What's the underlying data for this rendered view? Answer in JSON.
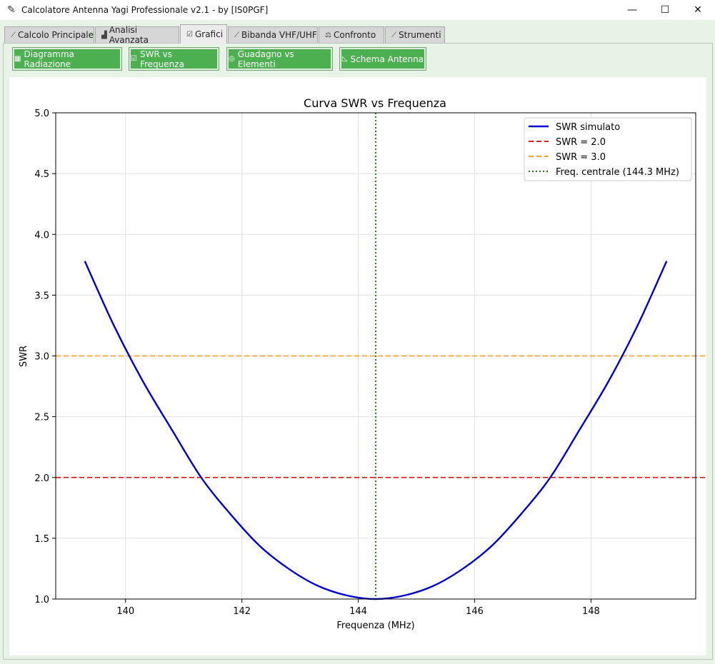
{
  "window": {
    "title": "Calcolatore Antenna Yagi Professionale v2.1 - by [IS0PGF]",
    "app_icon": "feather-icon",
    "controls": {
      "minimize": "—",
      "maximize": "☐",
      "close": "✕"
    }
  },
  "tabs": [
    {
      "label": "Calcolo Principale",
      "icon": "ruler-icon",
      "glyph": "⟋"
    },
    {
      "label": "Analisi Avanzata",
      "icon": "chart-bars-icon",
      "glyph": "▟"
    },
    {
      "label": "Grafici",
      "icon": "checkbox-chart-icon",
      "glyph": "☑"
    },
    {
      "label": "Bibanda VHF/UHF",
      "icon": "antenna-icon",
      "glyph": "⟋"
    },
    {
      "label": "Confronto",
      "icon": "balance-icon",
      "glyph": "⚖"
    },
    {
      "label": "Strumenti",
      "icon": "tools-icon",
      "glyph": "⟋"
    }
  ],
  "active_tab": "Grafici",
  "toolbar": {
    "buttons": [
      {
        "label": "Diagramma Radiazione",
        "icon": "radiation-chart-icon",
        "glyph": "▦"
      },
      {
        "label": "SWR vs Frequenza",
        "icon": "swr-chart-icon",
        "glyph": "☑"
      },
      {
        "label": "Guadagno vs Elementi",
        "icon": "gain-icon",
        "glyph": "◎"
      },
      {
        "label": "Schema Antenna",
        "icon": "antenna-scheme-icon",
        "glyph": "◺"
      }
    ],
    "button_color": "#4caf50"
  },
  "chart_data": {
    "type": "line",
    "title": "Curva SWR vs Frequenza",
    "xlabel": "Frequenza (MHz)",
    "ylabel": "SWR",
    "xlim": [
      138.8,
      149.8
    ],
    "ylim": [
      1.0,
      5.0
    ],
    "xticks": [
      "140",
      "142",
      "144",
      "146",
      "148"
    ],
    "yticks": [
      "1.0",
      "1.5",
      "2.0",
      "2.5",
      "3.0",
      "3.5",
      "4.0",
      "4.5",
      "5.0"
    ],
    "grid": true,
    "legend_position": "top-right",
    "series": [
      {
        "name": "SWR simulato",
        "color": "#0000cc",
        "style": "solid",
        "x": [
          139.3,
          139.8,
          140.3,
          140.8,
          141.3,
          141.8,
          142.3,
          142.8,
          143.3,
          143.8,
          144.3,
          144.8,
          145.3,
          145.8,
          146.3,
          146.8,
          147.3,
          147.8,
          148.3,
          148.8,
          149.3
        ],
        "y": [
          3.78,
          3.25,
          2.79,
          2.39,
          2.0,
          1.7,
          1.44,
          1.25,
          1.11,
          1.03,
          1.0,
          1.03,
          1.11,
          1.25,
          1.44,
          1.7,
          2.0,
          2.39,
          2.79,
          3.25,
          3.78
        ]
      },
      {
        "name": "SWR = 2.0",
        "color": "#dd0000",
        "style": "dashed",
        "y_const": 2.0
      },
      {
        "name": "SWR = 3.0",
        "color": "#f0a000",
        "style": "dashed",
        "y_const": 3.0
      },
      {
        "name": "Freq. centrale (144.3 MHz)",
        "color": "#006600",
        "style": "dotted",
        "x_const": 144.3
      }
    ]
  }
}
